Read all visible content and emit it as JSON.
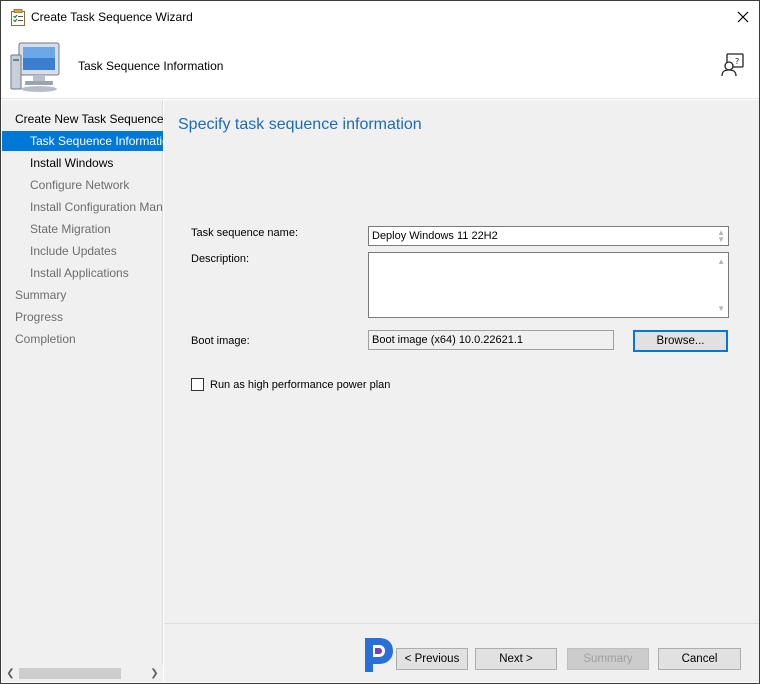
{
  "window": {
    "title": "Create Task Sequence Wizard"
  },
  "header": {
    "title": "Task Sequence Information"
  },
  "sidebar": {
    "items": [
      {
        "label": "Create New Task Sequence"
      },
      {
        "label": "Task Sequence Information"
      },
      {
        "label": "Install Windows"
      },
      {
        "label": "Configure Network"
      },
      {
        "label": "Install Configuration Manager"
      },
      {
        "label": "State Migration"
      },
      {
        "label": "Include Updates"
      },
      {
        "label": "Install Applications"
      },
      {
        "label": "Summary"
      },
      {
        "label": "Progress"
      },
      {
        "label": "Completion"
      }
    ]
  },
  "main": {
    "heading": "Specify task sequence information",
    "name_label": "Task sequence name:",
    "name_value": "Deploy Windows 11 22H2",
    "description_label": "Description:",
    "description_value": "",
    "boot_label": "Boot image:",
    "boot_value": "Boot image (x64) 10.0.22621.1",
    "browse_label": "Browse...",
    "checkbox_label": "Run as high performance power plan",
    "checkbox_checked": false
  },
  "footer": {
    "previous_label": "< Previous",
    "next_label": "Next >",
    "summary_label": "Summary",
    "cancel_label": "Cancel"
  },
  "colors": {
    "accent": "#0078d7",
    "heading": "#1e6bb8"
  }
}
